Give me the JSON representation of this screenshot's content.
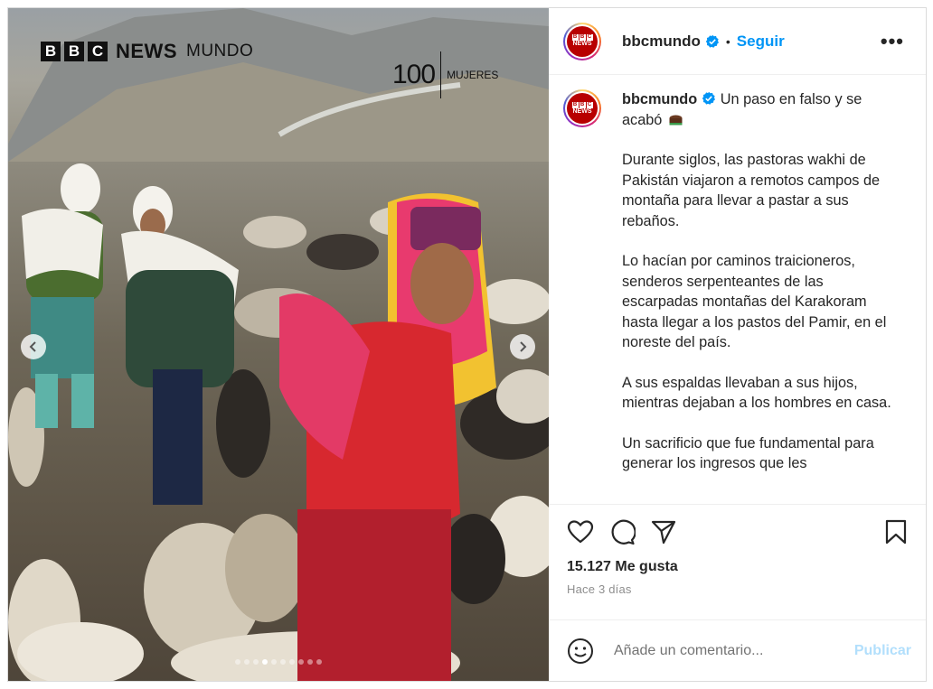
{
  "post": {
    "media": {
      "brand_logo": {
        "blocks": [
          "B",
          "B",
          "C"
        ],
        "news": "NEWS",
        "mundo": "MUNDO"
      },
      "series_logo": {
        "number": "100",
        "word": "MUJERES"
      },
      "carousel": {
        "slide_count": 10,
        "active_index": 3
      },
      "icons": {
        "prev": "chevron-left-icon",
        "next": "chevron-right-icon"
      }
    },
    "header": {
      "username": "bbcmundo",
      "verified": true,
      "separator": "•",
      "follow_label": "Seguir",
      "more_label": "•••"
    },
    "caption": {
      "username": "bbcmundo",
      "first_line": "Un paso en falso y se acabó",
      "emoji_icon": "cake-emoji-icon",
      "paragraphs": [
        "Durante siglos, las pastoras wakhi de Pakistán viajaron a remotos campos de montaña para llevar a pastar a sus rebaños.",
        "Lo hacían por caminos traicioneros, senderos serpenteantes de las escarpadas montañas del Karakoram hasta llegar a los pastos del Pamir, en el noreste del país.",
        "A sus espaldas llevaban a sus hijos, mientras dejaban a los hombres en casa.",
        "Un sacrificio que fue fundamental para generar los ingresos que les"
      ]
    },
    "actions": {
      "icons": [
        "heart-icon",
        "comment-icon",
        "share-icon",
        "bookmark-icon"
      ],
      "likes_text": "15.127 Me gusta",
      "date_text": "Hace 3 días"
    },
    "comment_box": {
      "emoji_icon": "smiley-icon",
      "placeholder": "Añade un comentario...",
      "publish_label": "Publicar"
    },
    "colors": {
      "accent": "#0095f6",
      "publish_disabled": "#b2dffc",
      "brand_red": "#b80000"
    }
  }
}
